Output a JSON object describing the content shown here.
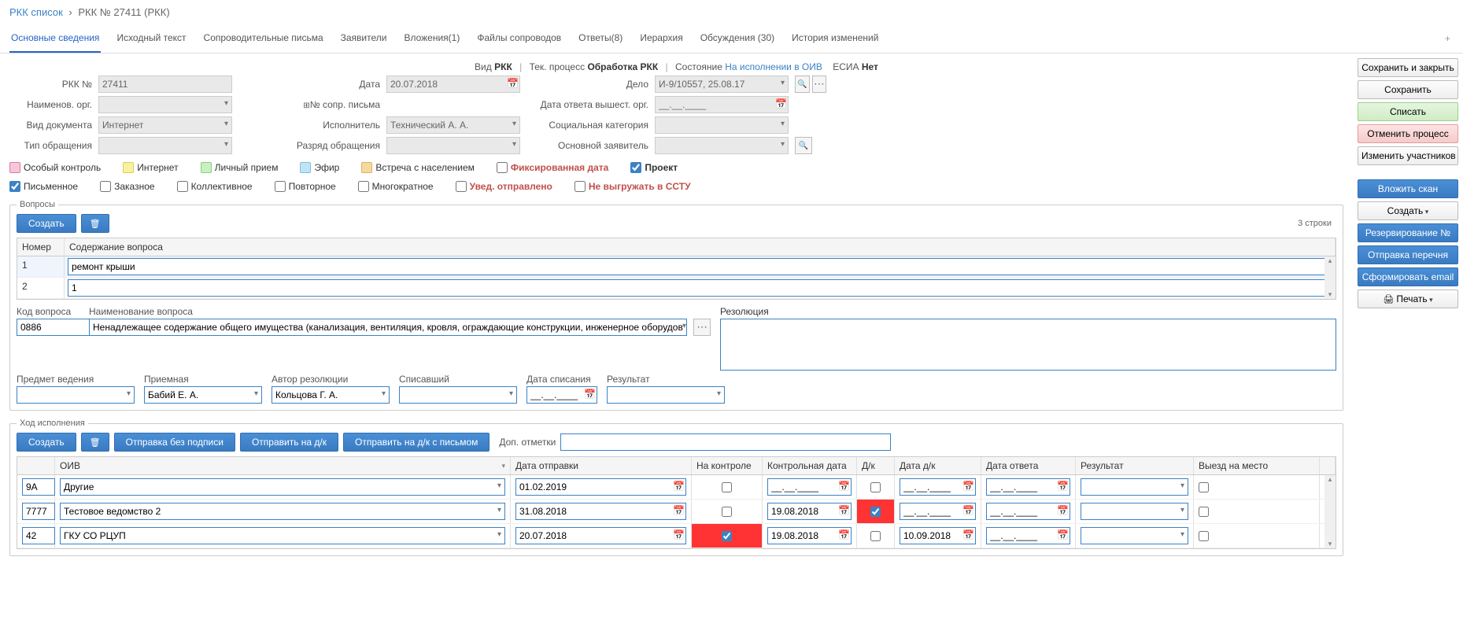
{
  "breadcrumb": {
    "root": "РКК список",
    "current": "РКК № 27411 (РКК)"
  },
  "tabs": {
    "items": [
      "Основные сведения",
      "Исходный текст",
      "Сопроводительные письма",
      "Заявители",
      "Вложения(1)",
      "Файлы сопроводов",
      "Ответы(8)",
      "Иерархия",
      "Обсуждения (30)",
      "История изменений"
    ],
    "active": 0
  },
  "statusline": {
    "vid_lbl": "Вид",
    "vid_val": "РКК",
    "proc_lbl": "Тек. процесс",
    "proc_val": "Обработка РКК",
    "state_lbl": "Состояние",
    "state_val": "На исполнении в ОИВ",
    "esia_lbl": "ЕСИА",
    "esia_val": "Нет"
  },
  "form": {
    "rkk_no_lbl": "РКК №",
    "rkk_no": "27411",
    "date_lbl": "Дата",
    "date": "20.07.2018",
    "delo_lbl": "Дело",
    "delo": "И-9/10557, 25.08.17",
    "org_lbl": "Наименов. орг.",
    "org": "",
    "sopr_lbl": "№ сопр. письма",
    "sopr": "",
    "ans_date_lbl": "Дата ответа вышест. орг.",
    "ans_date": "__.__.____",
    "doc_type_lbl": "Вид документа",
    "doc_type": "Интернет",
    "ispol_lbl": "Исполнитель",
    "ispol": "Технический А. А.",
    "soc_cat_lbl": "Социальная категория",
    "soc_cat": "",
    "appeal_type_lbl": "Тип обращения",
    "appeal_type": "",
    "razr_lbl": "Разряд обращения",
    "razr": "",
    "main_appl_lbl": "Основной заявитель",
    "main_appl": ""
  },
  "checks": {
    "special": "Особый контроль",
    "internet": "Интернет",
    "personal": "Личный прием",
    "efir": "Эфир",
    "meeting": "Встреча с населением",
    "fixed": "Фиксированная дата",
    "project": "Проект",
    "written": "Письменное",
    "zakaz": "Заказное",
    "collective": "Коллективное",
    "repeat": "Повторное",
    "multi": "Многократное",
    "notif": "Увед. отправлено",
    "nosstu": "Не выгружать в ССТУ"
  },
  "questions": {
    "legend": "Вопросы",
    "create": "Создать",
    "count": "3 строки",
    "cols": {
      "num": "Номер",
      "content": "Содержание вопроса"
    },
    "rows": [
      {
        "num": "1",
        "content": "ремонт крыши"
      },
      {
        "num": "2",
        "content": "1"
      }
    ],
    "code_lbl": "Код вопроса",
    "code": "0886",
    "name_lbl": "Наименование вопроса",
    "name": "Ненадлежащее содержание общего имущества (канализация, вентиляция, кровля, ограждающие конструкции, инженерное оборудование, места о",
    "subj_lbl": "Предмет ведения",
    "subj": "",
    "priem_lbl": "Приемная",
    "priem": "Бабий Е. А.",
    "author_lbl": "Автор резолюции",
    "author": "Кольцова Г. А.",
    "spis_lbl": "Списавший",
    "spis": "",
    "spisdate_lbl": "Дата списания",
    "spisdate": "__.__.____",
    "result_lbl": "Результат",
    "result": "",
    "resol_lbl": "Резолюция",
    "resol": ""
  },
  "exec": {
    "legend": "Ход исполнения",
    "create": "Создать",
    "send_nosign": "Отправка без подписи",
    "send_dk": "Отправить на д/к",
    "send_dk_letter": "Отправить на д/к с письмом",
    "extra_lbl": "Доп. отметки",
    "extra": "",
    "cols": {
      "oiv": "ОИВ",
      "sent": "Дата отправки",
      "ctrl": "На контроле",
      "ctrldate": "Контрольная дата",
      "dk": "Д/к",
      "dkdate": "Дата д/к",
      "ansdate": "Дата ответа",
      "result": "Результат",
      "visit": "Выезд на место"
    },
    "rows": [
      {
        "code": "9А",
        "name": "Другие",
        "sent": "01.02.2019",
        "ctrl": false,
        "ctrl_red": false,
        "ctrldate": "__.__.____",
        "dk": false,
        "dk_red": false,
        "dkdate": "__.__.____",
        "ansdate": "__.__.____",
        "result": "",
        "visit": false
      },
      {
        "code": "7777",
        "name": "Тестовое ведомство 2",
        "sent": "31.08.2018",
        "ctrl": false,
        "ctrl_red": false,
        "ctrldate": "19.08.2018",
        "dk": true,
        "dk_red": true,
        "dkdate": "__.__.____",
        "ansdate": "__.__.____",
        "result": "",
        "visit": false
      },
      {
        "code": "42",
        "name": "ГКУ СО РЦУП",
        "sent": "20.07.2018",
        "ctrl": true,
        "ctrl_red": true,
        "ctrldate": "19.08.2018",
        "dk": false,
        "dk_red": false,
        "dkdate": "10.09.2018",
        "ansdate": "__.__.____",
        "result": "",
        "visit": false
      }
    ]
  },
  "side": {
    "save_close": "Сохранить и закрыть",
    "save": "Сохранить",
    "writeoff": "Списать",
    "cancel_proc": "Отменить процесс",
    "change_part": "Изменить участников",
    "attach": "Вложить скан",
    "create": "Создать",
    "reserve": "Резервирование №",
    "sendlist": "Отправка перечня",
    "email": "Сформировать email",
    "print": "Печать"
  }
}
